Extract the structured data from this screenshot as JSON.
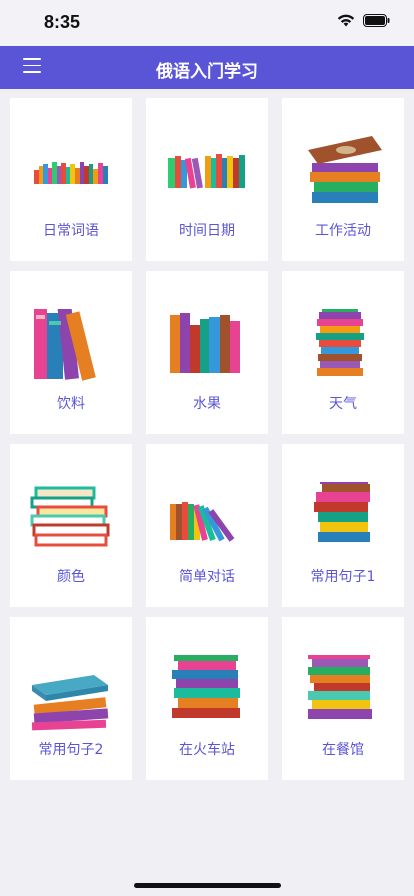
{
  "status_bar": {
    "time": "8:35"
  },
  "nav": {
    "title": "俄语入门学习",
    "menu_icon": "hamburger-menu-icon"
  },
  "categories": [
    {
      "label": "日常词语",
      "icon": "books-row-icon"
    },
    {
      "label": "时间日期",
      "icon": "books-leaning-icon"
    },
    {
      "label": "工作活动",
      "icon": "books-stack-icon"
    },
    {
      "label": "饮料",
      "icon": "books-tall-icon"
    },
    {
      "label": "水果",
      "icon": "books-row-icon"
    },
    {
      "label": "天气",
      "icon": "books-stack-icon"
    },
    {
      "label": "颜色",
      "icon": "books-stack-icon"
    },
    {
      "label": "简单对话",
      "icon": "books-leaning-icon"
    },
    {
      "label": "常用句子1",
      "icon": "books-stack-icon"
    },
    {
      "label": "常用句子2",
      "icon": "books-stack-icon"
    },
    {
      "label": "在火车站",
      "icon": "books-stack-icon"
    },
    {
      "label": "在餐馆",
      "icon": "books-stack-icon"
    }
  ],
  "colors": {
    "accent": "#5a55d6",
    "background": "#efeff4",
    "card": "#ffffff"
  }
}
